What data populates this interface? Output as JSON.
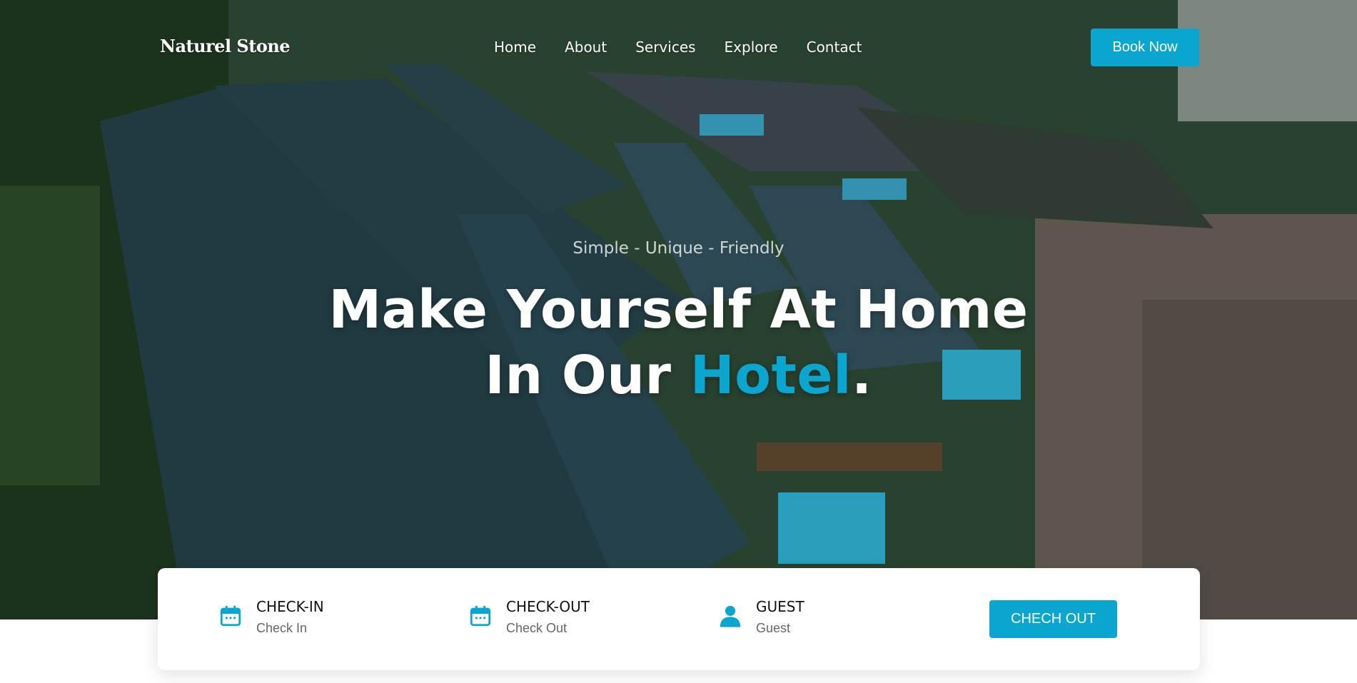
{
  "brand": {
    "logo_text": "Naturel Stone",
    "accent_color": "#0aa6cf"
  },
  "nav": {
    "items": [
      {
        "label": "Home"
      },
      {
        "label": "About"
      },
      {
        "label": "Services"
      },
      {
        "label": "Explore"
      },
      {
        "label": "Contact"
      }
    ]
  },
  "header": {
    "book_label": "Book Now"
  },
  "hero": {
    "tagline": "Simple - Unique - Friendly",
    "headline_line1": "Make Yourself At Home",
    "headline_line2_prefix": "In Our ",
    "headline_highlight": "Hotel",
    "headline_suffix": "."
  },
  "booking": {
    "checkin": {
      "title": "CHECK-IN",
      "placeholder": "Check In",
      "icon": "calendar-icon"
    },
    "checkout": {
      "title": "CHECK-OUT",
      "placeholder": "Check Out",
      "icon": "calendar-icon"
    },
    "guest": {
      "title": "GUEST",
      "placeholder": "Guest",
      "icon": "user-icon"
    },
    "submit_label": "CHECH OUT"
  }
}
